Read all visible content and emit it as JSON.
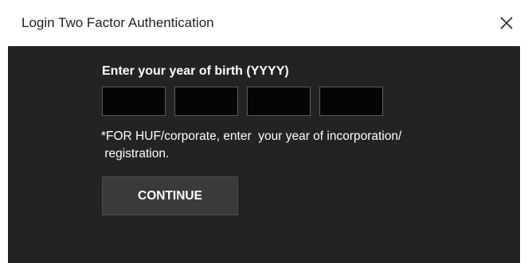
{
  "window": {
    "title": "Login Two Factor Authentication",
    "close_icon": "close-icon"
  },
  "form": {
    "prompt": "Enter your year of birth (YYYY)",
    "digits": [
      "",
      "",
      "",
      ""
    ],
    "note": "*FOR HUF/corporate, enter  your year of incorporation/\n registration.",
    "continue_label": "CONTINUE"
  },
  "colors": {
    "titlebar_bg": "#ffffff",
    "panel_bg": "#232323",
    "input_bg": "#050505",
    "button_bg": "#3a3a3a",
    "text": "#ffffff"
  }
}
